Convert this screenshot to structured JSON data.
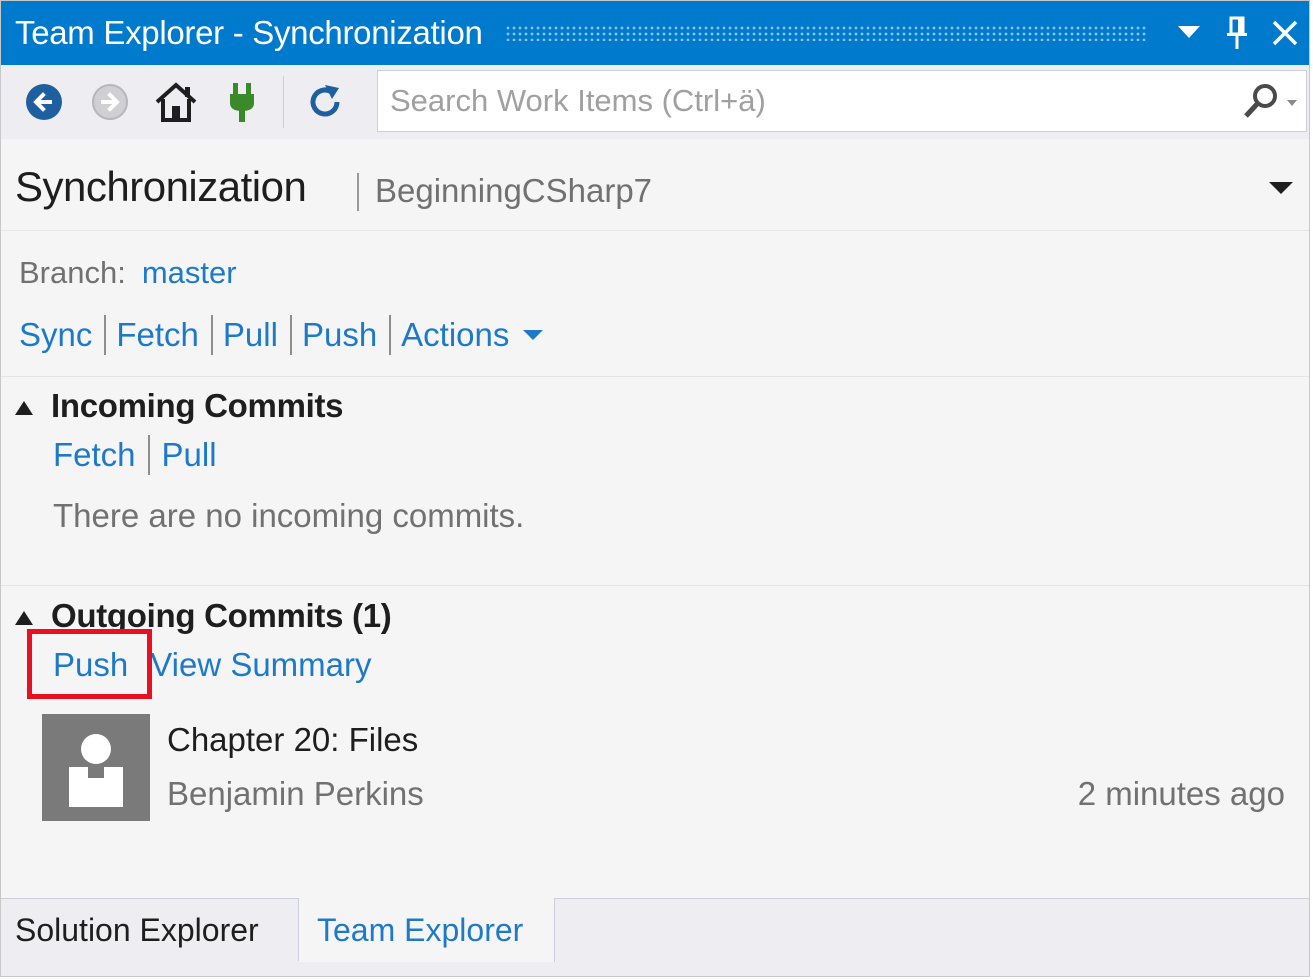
{
  "window": {
    "title": "Team Explorer - Synchronization",
    "colors": {
      "titlebar": "#007acc",
      "link": "#1e7ac8",
      "highlight": "#e81123",
      "nav_back": "#1e5f9f",
      "plug": "#3a8a2a"
    }
  },
  "toolbar": {
    "icons": [
      "back-icon",
      "forward-icon",
      "home-icon",
      "connect-icon",
      "refresh-icon"
    ],
    "search": {
      "placeholder": "Search Work Items (Ctrl+ä)",
      "value": ""
    }
  },
  "header": {
    "page_title": "Synchronization",
    "repo_name": "BeginningCSharp7"
  },
  "branch": {
    "label": "Branch:",
    "value": "master"
  },
  "actions": {
    "sync": "Sync",
    "fetch": "Fetch",
    "pull": "Pull",
    "push": "Push",
    "actions": "Actions"
  },
  "incoming": {
    "title": "Incoming Commits",
    "fetch": "Fetch",
    "pull": "Pull",
    "empty_message": "There are no incoming commits."
  },
  "outgoing": {
    "title": "Outgoing Commits (1)",
    "push": "Push",
    "view_summary": "View Summary",
    "commits": [
      {
        "title": "Chapter 20: Files",
        "author": "Benjamin Perkins",
        "time": "2 minutes ago"
      }
    ]
  },
  "tabs": {
    "solution_explorer": "Solution Explorer",
    "team_explorer": "Team Explorer",
    "active": "Team Explorer"
  }
}
